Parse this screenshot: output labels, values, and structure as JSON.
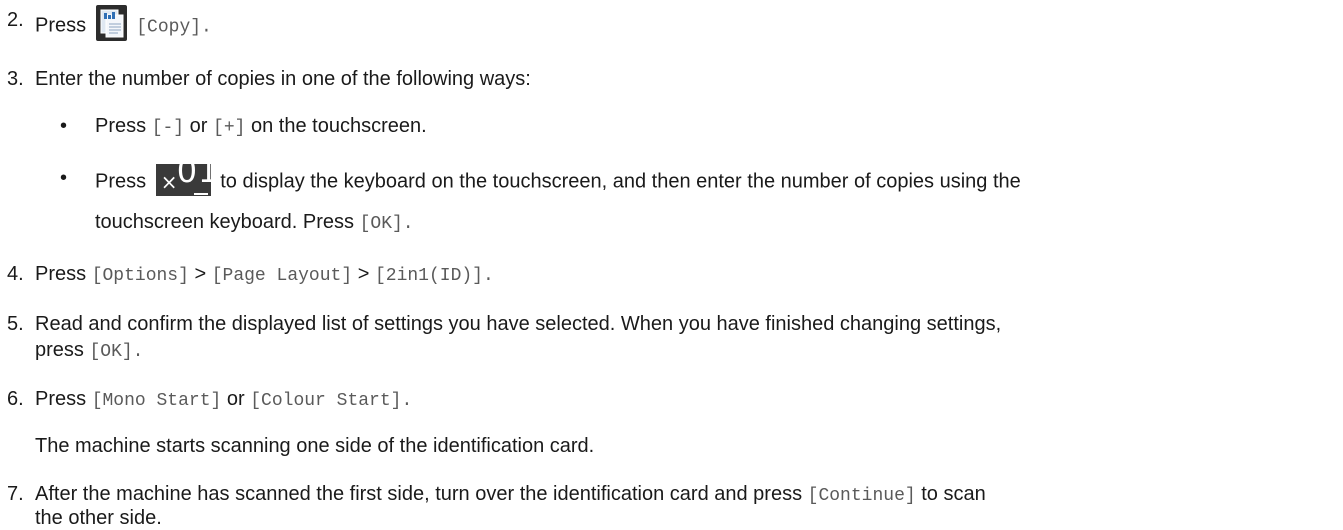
{
  "steps": {
    "s2": {
      "num": "2.",
      "t1": "Press",
      "code": "[Copy]."
    },
    "s3": {
      "num": "3.",
      "text": "Enter the number of copies in one of the following ways:"
    },
    "s3a": {
      "bullet": "•",
      "t1": "Press",
      "c1": "[-]",
      "t2": "or",
      "c2": "[+]",
      "t3": "on the touchscreen."
    },
    "s3b": {
      "bullet": "•",
      "t1": "Press",
      "x": "×",
      "digits": "01",
      "t2": "to display the keyboard on the touchscreen, and then enter the number of copies using the",
      "t3": "touchscreen keyboard. Press",
      "code": "[OK]."
    },
    "s4": {
      "num": "4.",
      "t1": "Press",
      "c1": "[Options]",
      "sep1": ">",
      "c2": "[Page Layout]",
      "sep2": ">",
      "c3": "[2in1(ID)]."
    },
    "s5": {
      "num": "5.",
      "t1": "Read and confirm the displayed list of settings you have selected. When you have finished changing settings,",
      "t2": "press",
      "code": "[OK]."
    },
    "s6": {
      "num": "6.",
      "t1": "Press",
      "c1": "[Mono Start]",
      "t2": "or",
      "c2": "[Colour Start].",
      "sub": "The machine starts scanning one side of the identification card."
    },
    "s7": {
      "num": "7.",
      "t1": "After the machine has scanned the first side, turn over the identification card and press",
      "code": "[Continue]",
      "t2": "to scan",
      "t3": "the other side."
    }
  },
  "icons": {
    "copy": "copy-document-icon",
    "counter": "copies-counter-button"
  }
}
